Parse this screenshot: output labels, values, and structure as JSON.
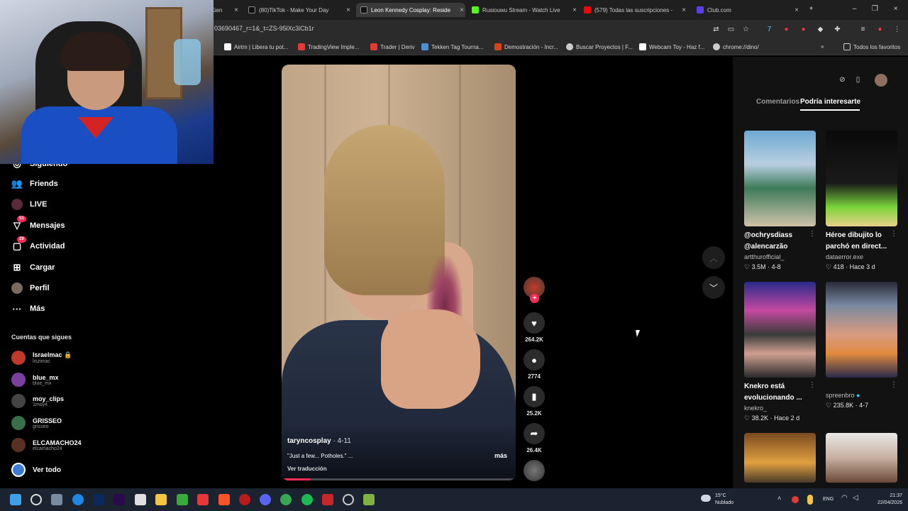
{
  "browser": {
    "tabs": [
      {
        "title": "üen",
        "color": "#d44"
      },
      {
        "title": "(80)TikTok - Make Your Day",
        "color": "#111"
      },
      {
        "title": "Leon Kennedy Cosplay: Reside",
        "color": "#111"
      },
      {
        "title": "Rusiouwu Stream - Watch Live",
        "color": "#53fc18"
      },
      {
        "title": "(579) Todas las suscripciones -",
        "color": "#ff0000"
      },
      {
        "title": "Club.com",
        "color": "#5b3ff0"
      }
    ],
    "url": "03690467_r=1&_t=ZS-95lXc3iCb1r",
    "bookmarks": [
      {
        "label": "Airtm | Libera tu pot...",
        "color": "#ffffff"
      },
      {
        "label": "TradingView Imple...",
        "color": "#e53935"
      },
      {
        "label": "Trader | Deriv",
        "color": "#e53935"
      },
      {
        "label": "Tekken Tag Tourna...",
        "color": "#4a90d9"
      },
      {
        "label": "Demostración - Incr...",
        "color": "#d84315"
      },
      {
        "label": "Buscar Proyectos | F...",
        "color": "#cccccc"
      },
      {
        "label": "Webcam Toy - Haz f...",
        "color": "#ffffff"
      },
      {
        "label": "chrome://dino/",
        "color": "#cccccc"
      }
    ],
    "all_bookmarks": "Todos los favoritos"
  },
  "nav": {
    "following": "Siguiendo",
    "friends": "Friends",
    "live": "LIVE",
    "messages": "Mensajes",
    "messages_badge": "51",
    "activity": "Actividad",
    "activity_badge": "29",
    "upload": "Cargar",
    "profile": "Perfil",
    "more": "Más"
  },
  "following_accounts": {
    "title": "Cuentas que sigues",
    "items": [
      {
        "name": "Israelmac 🔒",
        "handle": "liszimac",
        "color": "#c0392b"
      },
      {
        "name": "blue_mx",
        "handle": "blue_mx",
        "color": "#7b3fa0"
      },
      {
        "name": "moy_clips",
        "handle": "1moy4",
        "color": "#444444"
      },
      {
        "name": "GRISSEO",
        "handle": "grisseo",
        "color": "#3a6e4a"
      },
      {
        "name": "ELCAMACHO24",
        "handle": "elcamacho24",
        "color": "#5a3020"
      }
    ],
    "see_all": "Ver todo"
  },
  "video": {
    "author": "taryncosplay",
    "date": "· 4-11",
    "description": "\"Just a few... Potholes.\" ...",
    "more": "más",
    "translate": "Ver traducción",
    "progress": 0.12
  },
  "actions": {
    "likes": "264.2K",
    "comments": "2774",
    "saves": "25.2K",
    "shares": "26.4K"
  },
  "right_panel": {
    "tabs": [
      "Comentarios",
      "Podría interesarte"
    ],
    "videos": [
      {
        "title": "@ochrysdiass @alencarzão",
        "author": "artthurofficial_",
        "likes": "3.5M",
        "date": "4-8",
        "colors": [
          "#4a7a9a",
          "#d8c8a8"
        ]
      },
      {
        "title": "Héroe dibujito lo parchó en direct...",
        "author": "dataerror.exe",
        "likes": "418",
        "date": "Hace 3 d",
        "colors": [
          "#0a0a0a",
          "#7bd43a"
        ]
      },
      {
        "title": "Knekro está evolucionando ...",
        "author": "knekro_",
        "likes": "38.2K",
        "date": "Hace 2 d",
        "colors": [
          "#2a2a8a",
          "#c44aa0"
        ]
      },
      {
        "title": "",
        "author": "spreenbro",
        "likes": "235.8K",
        "date": "4-7",
        "colors": [
          "#7a8aa0",
          "#c88a70"
        ]
      },
      {
        "title": "",
        "author": "",
        "likes": "",
        "date": "",
        "colors": [
          "#7a4a20",
          "#e0a040"
        ]
      },
      {
        "title": "",
        "author": "",
        "likes": "",
        "date": "",
        "colors": [
          "#e8e8e8",
          "#c89070"
        ]
      }
    ]
  },
  "taskbar": {
    "temp": "15°C",
    "weather": "Nublado",
    "lang": "ENG",
    "time": "21:37",
    "date": "22/04/2026"
  }
}
